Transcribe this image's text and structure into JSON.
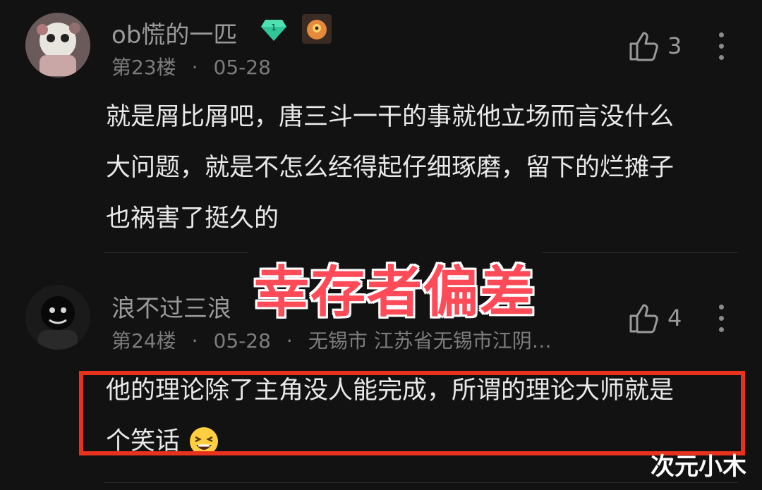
{
  "comments": [
    {
      "username": "ob慌的一匹",
      "level": "1",
      "floor": "第23楼",
      "dot": "·",
      "date": "05-28",
      "location": "",
      "likes": "3",
      "text_lines": [
        "就是屑比屑吧，唐三斗一干的事就他立场而言没什么",
        "大问题，就是不怎么经得起仔细琢磨，留下的烂摊子",
        "也祸害了挺久的"
      ]
    },
    {
      "username": "浪不过三浪",
      "floor": "第24楼",
      "dot": "·",
      "dot2": "·",
      "date": "05-28",
      "location": "无锡市 江苏省无锡市江阴…",
      "likes": "4",
      "text_lines": [
        "他的理论除了主角没人能完成，所谓的理论大师就是",
        "个笑话"
      ]
    }
  ],
  "overlay_title": "幸存者偏差",
  "watermark": "次元小木",
  "colors": {
    "background": "#121212",
    "overlay_red": "#ff4a57",
    "highlight_box": "#e8321d",
    "level_badge": "#2fc79a"
  },
  "icons": {
    "like": "thumbs-up-icon",
    "more": "more-vertical-icon",
    "badge": "diamond-level-icon",
    "medal": "fan-medal-icon",
    "emoji": "laughing-emoji-icon"
  }
}
